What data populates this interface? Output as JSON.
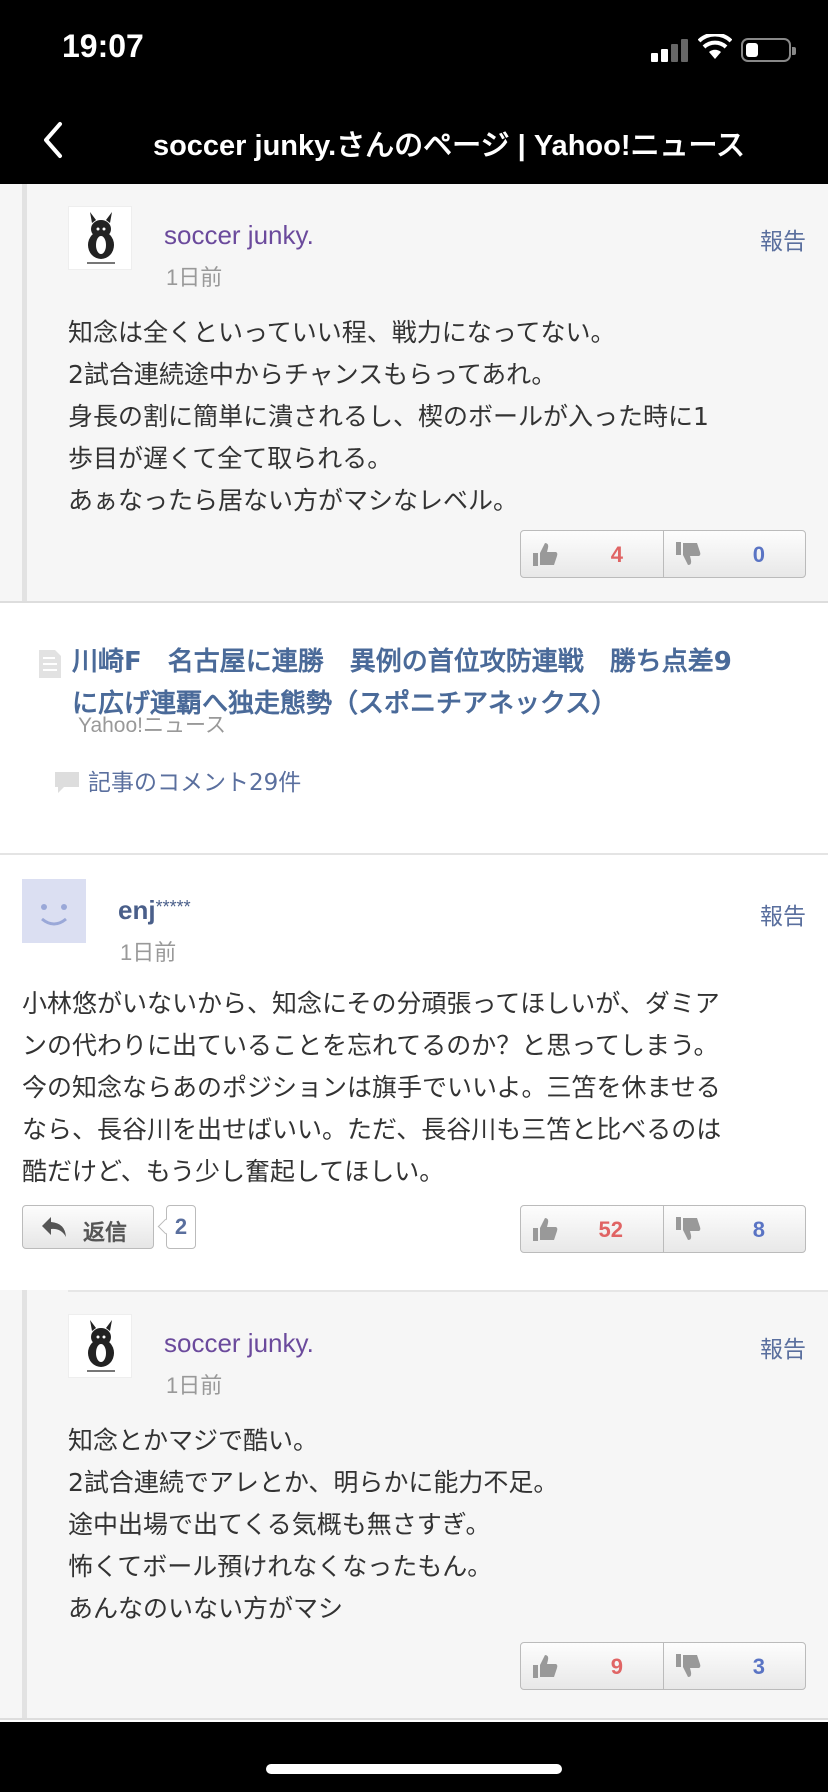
{
  "status": {
    "time": "19:07"
  },
  "nav": {
    "title": "soccer junky.さんのページ | Yahoo!ニュース"
  },
  "reply1": {
    "user": "soccer junky.",
    "ago": "1日前",
    "report": "報告",
    "lines": [
      "知念は全くといっていい程、戦力になってない。",
      "2試合連続途中からチャンスもらってあれ。",
      "身長の割に簡単に潰されるし、楔のボールが入った時に1",
      "歩目が遅くて全て取られる。",
      "あぁなったら居ない方がマシなレベル。"
    ],
    "likes": "4",
    "dislikes": "0"
  },
  "article": {
    "title_line1": "川崎F　名古屋に連勝　異例の首位攻防連戦　勝ち点差9",
    "title_line2": "に広げ連覇へ独走態勢（スポニチアネックス）",
    "source": "Yahoo!ニュース",
    "comments_link": "記事のコメント29件"
  },
  "comment": {
    "user": "enj",
    "user_masked": "*****",
    "ago": "1日前",
    "report": "報告",
    "lines": [
      "小林悠がいないから、知念にその分頑張ってほしいが、ダミア",
      "ンの代わりに出ていることを忘れてるのか？と思ってしまう。",
      "今の知念ならあのポジションは旗手でいいよ。三笘を休ませる",
      "なら、長谷川を出せばいい。ただ、長谷川も三笘と比べるのは",
      "酷だけど、もう少し奮起してほしい。"
    ],
    "reply_label": "返信",
    "reply_count": "2",
    "likes": "52",
    "dislikes": "8"
  },
  "reply2": {
    "user": "soccer junky.",
    "ago": "1日前",
    "report": "報告",
    "lines": [
      "知念とかマジで酷い。",
      "2試合連続でアレとか、明らかに能力不足。",
      "途中出場で出てくる気概も無さすぎ。",
      "怖くてボール預けれなくなったもん。",
      "あんなのいない方がマシ"
    ],
    "likes": "9",
    "dislikes": "3"
  }
}
